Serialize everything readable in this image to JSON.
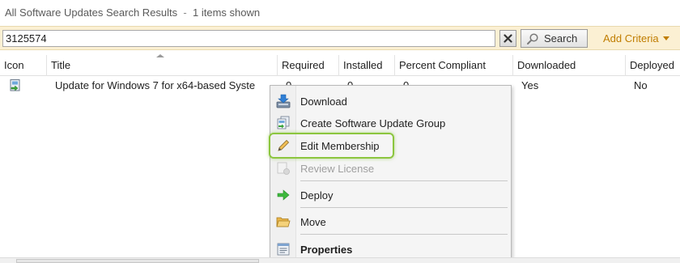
{
  "header": {
    "title": "All Software Updates Search Results",
    "separator": "-",
    "count_text": "1 items shown"
  },
  "search": {
    "value": "3125574",
    "clear_icon": "close-icon",
    "search_label": "Search",
    "search_icon": "magnifier-icon",
    "add_criteria_label": "Add Criteria"
  },
  "grid": {
    "columns": [
      "Icon",
      "Title",
      "Required",
      "Installed",
      "Percent Compliant",
      "Downloaded",
      "Deployed"
    ],
    "rows": [
      {
        "icon": "software-update-icon",
        "title": "Update for Windows 7 for x64-based Syste",
        "required": "0",
        "installed": "0",
        "percent_compliant": "0",
        "downloaded": "Yes",
        "deployed": "No"
      }
    ]
  },
  "context_menu": {
    "items": [
      {
        "label": "Download",
        "icon": "download-icon",
        "enabled": true
      },
      {
        "label": "Create Software Update Group",
        "icon": "update-group-icon",
        "enabled": true
      },
      {
        "label": "Edit Membership",
        "icon": "pencil-icon",
        "enabled": true,
        "highlighted": true
      },
      {
        "label": "Review License",
        "icon": "license-icon",
        "enabled": false
      },
      {
        "label": "Deploy",
        "icon": "green-arrow-icon",
        "enabled": true
      },
      {
        "label": "Move",
        "icon": "folder-icon",
        "enabled": true
      },
      {
        "label": "Properties",
        "icon": "properties-icon",
        "enabled": true,
        "bold": true
      }
    ]
  },
  "colors": {
    "search_bar_bg": "#fbf0d3",
    "add_criteria": "#c07d00",
    "highlight_border": "#8cc63f"
  }
}
